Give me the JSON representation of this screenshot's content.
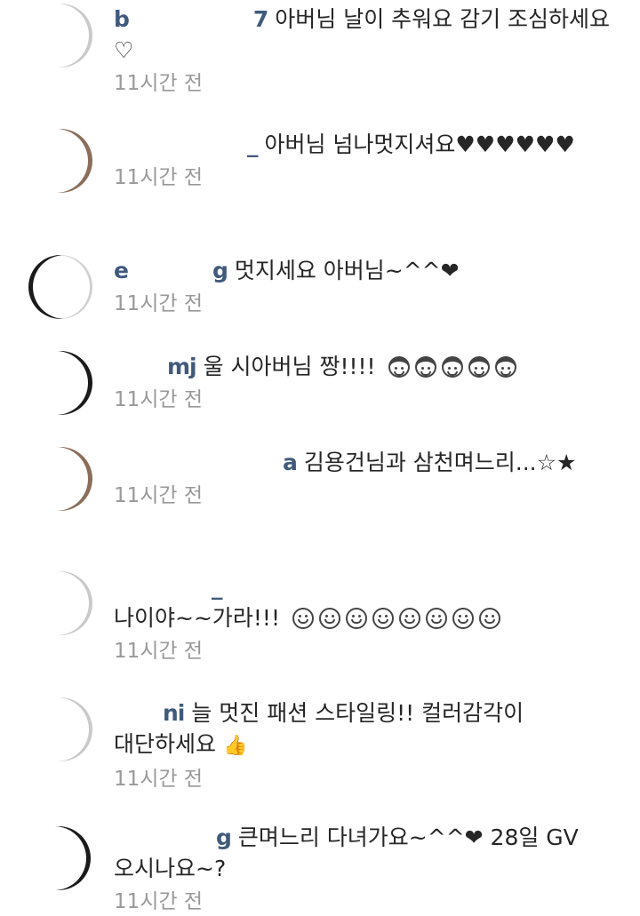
{
  "comments": [
    {
      "username": "b",
      "username_tail": "7",
      "text": " 아버님 날이 추워요 감기 조심하세요♡",
      "time": "11시간 전"
    },
    {
      "username": "",
      "username_tail": "_",
      "text": " 아버님 넘나멋지셔요♥♥♥♥♥♥",
      "time": "11시간 전"
    },
    {
      "username": "e",
      "username_tail": "g",
      "text": " 멋지세요 아버님~^^❤",
      "time": "11시간 전"
    },
    {
      "username": "",
      "username_tail": "mj",
      "text": " 울 시아버님 짱!!!!",
      "time": "11시간 전"
    },
    {
      "username": "",
      "username_tail": "a",
      "text": " 김용건님과 삼천며느리...☆★",
      "time": "11시간 전"
    },
    {
      "username": "",
      "username_tail": "_",
      "text": "나이야~~가라!!!",
      "time": "11시간 전"
    },
    {
      "username": "",
      "username_tail": "ni",
      "text": " 늘 멋진 패션 스타일링!! 컬러감각이 대단하세요",
      "time": "11시간 전"
    },
    {
      "username": "",
      "username_tail": "g",
      "text": " 큰며느리 다녀가요~^^❤ 28일 GV 오시나요~?",
      "time": "11시간 전"
    }
  ],
  "icons": {
    "emoji_girl": "girl-face-emoji-icon",
    "emoji_grin": "grinning-face-emoji-icon",
    "emoji_thumbs": "thumbs-up-emoji-icon"
  },
  "colors": {
    "username": "#1f3e64",
    "text": "#262626",
    "time": "#999999"
  }
}
